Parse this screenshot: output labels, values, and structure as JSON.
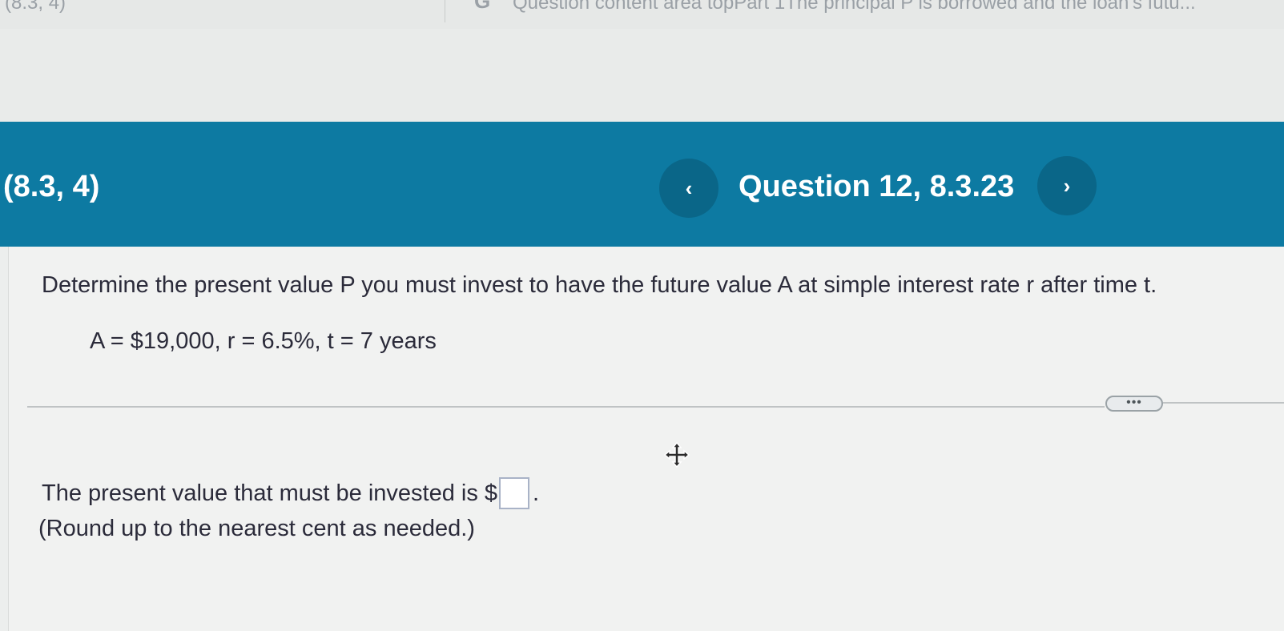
{
  "browser": {
    "prev_tab_title": "(8.3, 4)",
    "active_tab_title": "Question content area topPart 1The principal P is borrowed and the loan's futu..."
  },
  "header": {
    "section_label": "(8.3, 4)",
    "question_title": "Question 12, 8.3.23",
    "prev_symbol": "‹",
    "next_symbol": "›",
    "bar_color": "#0d7aa2"
  },
  "question": {
    "prompt": "Determine the present value P you must invest to have the future value A at simple interest rate r after time t.",
    "given": "A = $19,000, r = 6.5%, t = 7 years"
  },
  "toolbar": {
    "more_label": "•••"
  },
  "answer": {
    "prefix": "The present value that must be invested is $",
    "value": "",
    "suffix": ".",
    "hint": "(Round up to the nearest cent as needed.)"
  },
  "icons": {
    "google": "google-icon",
    "move": "move-icon",
    "prev": "chevron-left-icon",
    "next": "chevron-right-icon"
  }
}
